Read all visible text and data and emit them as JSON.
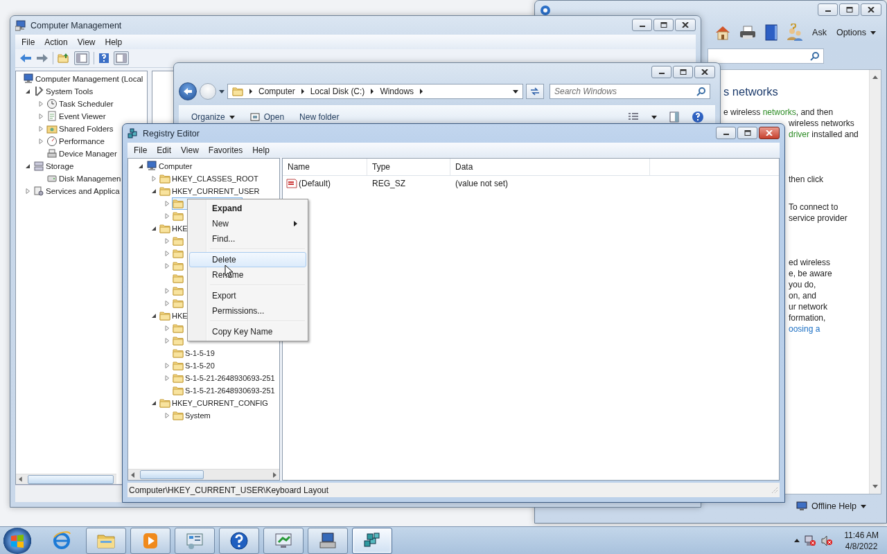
{
  "help_window": {
    "toolbar": {
      "ask": "Ask",
      "options": "Options"
    },
    "article": {
      "heading": "s networks",
      "top_lines": [
        [
          {
            "text": "e wireless "
          },
          {
            "text": "networks",
            "kind": "glossary"
          },
          {
            "text": ", and then"
          }
        ]
      ],
      "paragraphs": [
        [
          [
            {
              "text": "wireless networks"
            }
          ],
          [
            {
              "text": "driver",
              "kind": "glossary"
            },
            {
              "text": " installed and"
            }
          ]
        ],
        [
          [
            {
              "text": "then click"
            }
          ]
        ],
        [
          [
            {
              "text": "To connect to"
            }
          ],
          [
            {
              "text": "service provider"
            }
          ]
        ],
        [
          [
            {
              "text": "ed wireless"
            }
          ],
          [
            {
              "text": "e, be aware"
            }
          ],
          [
            {
              "text": "you do,"
            }
          ],
          [
            {
              "text": "on, and"
            }
          ],
          [
            {
              "text": "ur network"
            }
          ],
          [
            {
              "text": "formation,"
            }
          ],
          [
            {
              "text": "oosing a",
              "kind": "link"
            }
          ]
        ]
      ]
    },
    "footer": "Offline Help"
  },
  "computer_management": {
    "title": "Computer Management",
    "menu": [
      "File",
      "Action",
      "View",
      "Help"
    ],
    "tree": [
      {
        "label": "Computer Management (Local",
        "selected": false,
        "children": [
          {
            "label": "System Tools",
            "expanded": true,
            "selected": false,
            "children": [
              {
                "label": "Task Scheduler",
                "expanded": false,
                "selected": false
              },
              {
                "label": "Event Viewer",
                "expanded": false,
                "selected": false
              },
              {
                "label": "Shared Folders",
                "expanded": false,
                "selected": false
              },
              {
                "label": "Performance",
                "expanded": false,
                "selected": false
              },
              {
                "label": "Device Manager",
                "selected": false
              }
            ]
          },
          {
            "label": "Storage",
            "expanded": true,
            "selected": false,
            "children": [
              {
                "label": "Disk Managemen",
                "selected": false
              }
            ]
          },
          {
            "label": "Services and Applica",
            "expanded": false,
            "selected": false
          }
        ]
      }
    ]
  },
  "explorer": {
    "breadcrumb": [
      "Computer",
      "Local Disk (C:)",
      "Windows"
    ],
    "search": {
      "placeholder": "Search Windows"
    },
    "toolbar": [
      {
        "label": "Organize",
        "kind": "menu"
      },
      {
        "label": "Open",
        "kind": "icon"
      },
      {
        "label": "New folder",
        "kind": "plain"
      }
    ]
  },
  "registry": {
    "title": "Registry Editor",
    "menu": [
      "File",
      "Edit",
      "View",
      "Favorites",
      "Help"
    ],
    "tree": [
      {
        "label": "Computer",
        "expanded": true,
        "selected": false,
        "children": [
          {
            "label": "HKEY_CLASSES_ROOT",
            "expanded": false,
            "selected": false
          },
          {
            "label": "HKEY_CURRENT_USER",
            "expanded": true,
            "selected": false,
            "children": [
              {
                "expanded": false,
                "selected": true
              },
              {
                "expanded": false,
                "selected": false
              }
            ]
          },
          {
            "label": "HKE",
            "expanded": true,
            "selected": false,
            "children": [
              {
                "expanded": false,
                "selected": false
              },
              {
                "expanded": false,
                "selected": false
              },
              {
                "expanded": false,
                "selected": false
              },
              {
                "selected": false
              },
              {
                "expanded": false,
                "selected": false
              },
              {
                "expanded": false,
                "selected": false
              }
            ]
          },
          {
            "label": "HKE",
            "expanded": true,
            "selected": false,
            "children": [
              {
                "expanded": false,
                "selected": false
              },
              {
                "expanded": false,
                "selected": false
              },
              {
                "label": "S-1-5-19",
                "selected": false
              },
              {
                "label": "S-1-5-20",
                "expanded": false,
                "selected": false
              },
              {
                "label": "S-1-5-21-2648930693-251",
                "expanded": false,
                "selected": false
              },
              {
                "label": "S-1-5-21-2648930693-251",
                "selected": false
              }
            ]
          },
          {
            "label": "HKEY_CURRENT_CONFIG",
            "expanded": true,
            "selected": false,
            "children": [
              {
                "label": "System",
                "expanded": false,
                "selected": false
              }
            ]
          }
        ]
      }
    ],
    "columns": [
      "Name",
      "Type",
      "Data"
    ],
    "rows": [
      {
        "name": "(Default)",
        "type": "REG_SZ",
        "data": "(value not set)"
      }
    ],
    "status_bar": "Computer\\HKEY_CURRENT_USER\\Keyboard Layout"
  },
  "context_menu": {
    "items": [
      {
        "kind": "item",
        "label": "Expand",
        "default": true,
        "submenu": false,
        "selected": false
      },
      {
        "kind": "item",
        "label": "New",
        "default": false,
        "submenu": true,
        "selected": false
      },
      {
        "kind": "item",
        "label": "Find...",
        "default": false,
        "submenu": false,
        "selected": false
      },
      {
        "kind": "separator"
      },
      {
        "kind": "item",
        "label": "Delete",
        "default": false,
        "submenu": false,
        "selected": true
      },
      {
        "kind": "item",
        "label": "Rename",
        "default": false,
        "submenu": false,
        "selected": false
      },
      {
        "kind": "separator"
      },
      {
        "kind": "item",
        "label": "Export",
        "default": false,
        "submenu": false,
        "selected": false
      },
      {
        "kind": "item",
        "label": "Permissions...",
        "default": false,
        "submenu": false,
        "selected": false
      },
      {
        "kind": "separator"
      },
      {
        "kind": "item",
        "label": "Copy Key Name",
        "default": false,
        "submenu": false,
        "selected": false
      }
    ]
  },
  "taskbar": {
    "buttons": [
      {
        "running": false,
        "selected": false
      },
      {
        "running": true,
        "selected": false
      },
      {
        "running": true,
        "selected": false
      },
      {
        "running": true,
        "selected": false
      },
      {
        "running": true,
        "selected": false
      },
      {
        "running": true,
        "selected": false
      },
      {
        "running": true,
        "selected": false
      },
      {
        "running": true,
        "selected": true
      }
    ],
    "clock": {
      "time": "11:46 AM",
      "date": "4/8/2022"
    }
  }
}
